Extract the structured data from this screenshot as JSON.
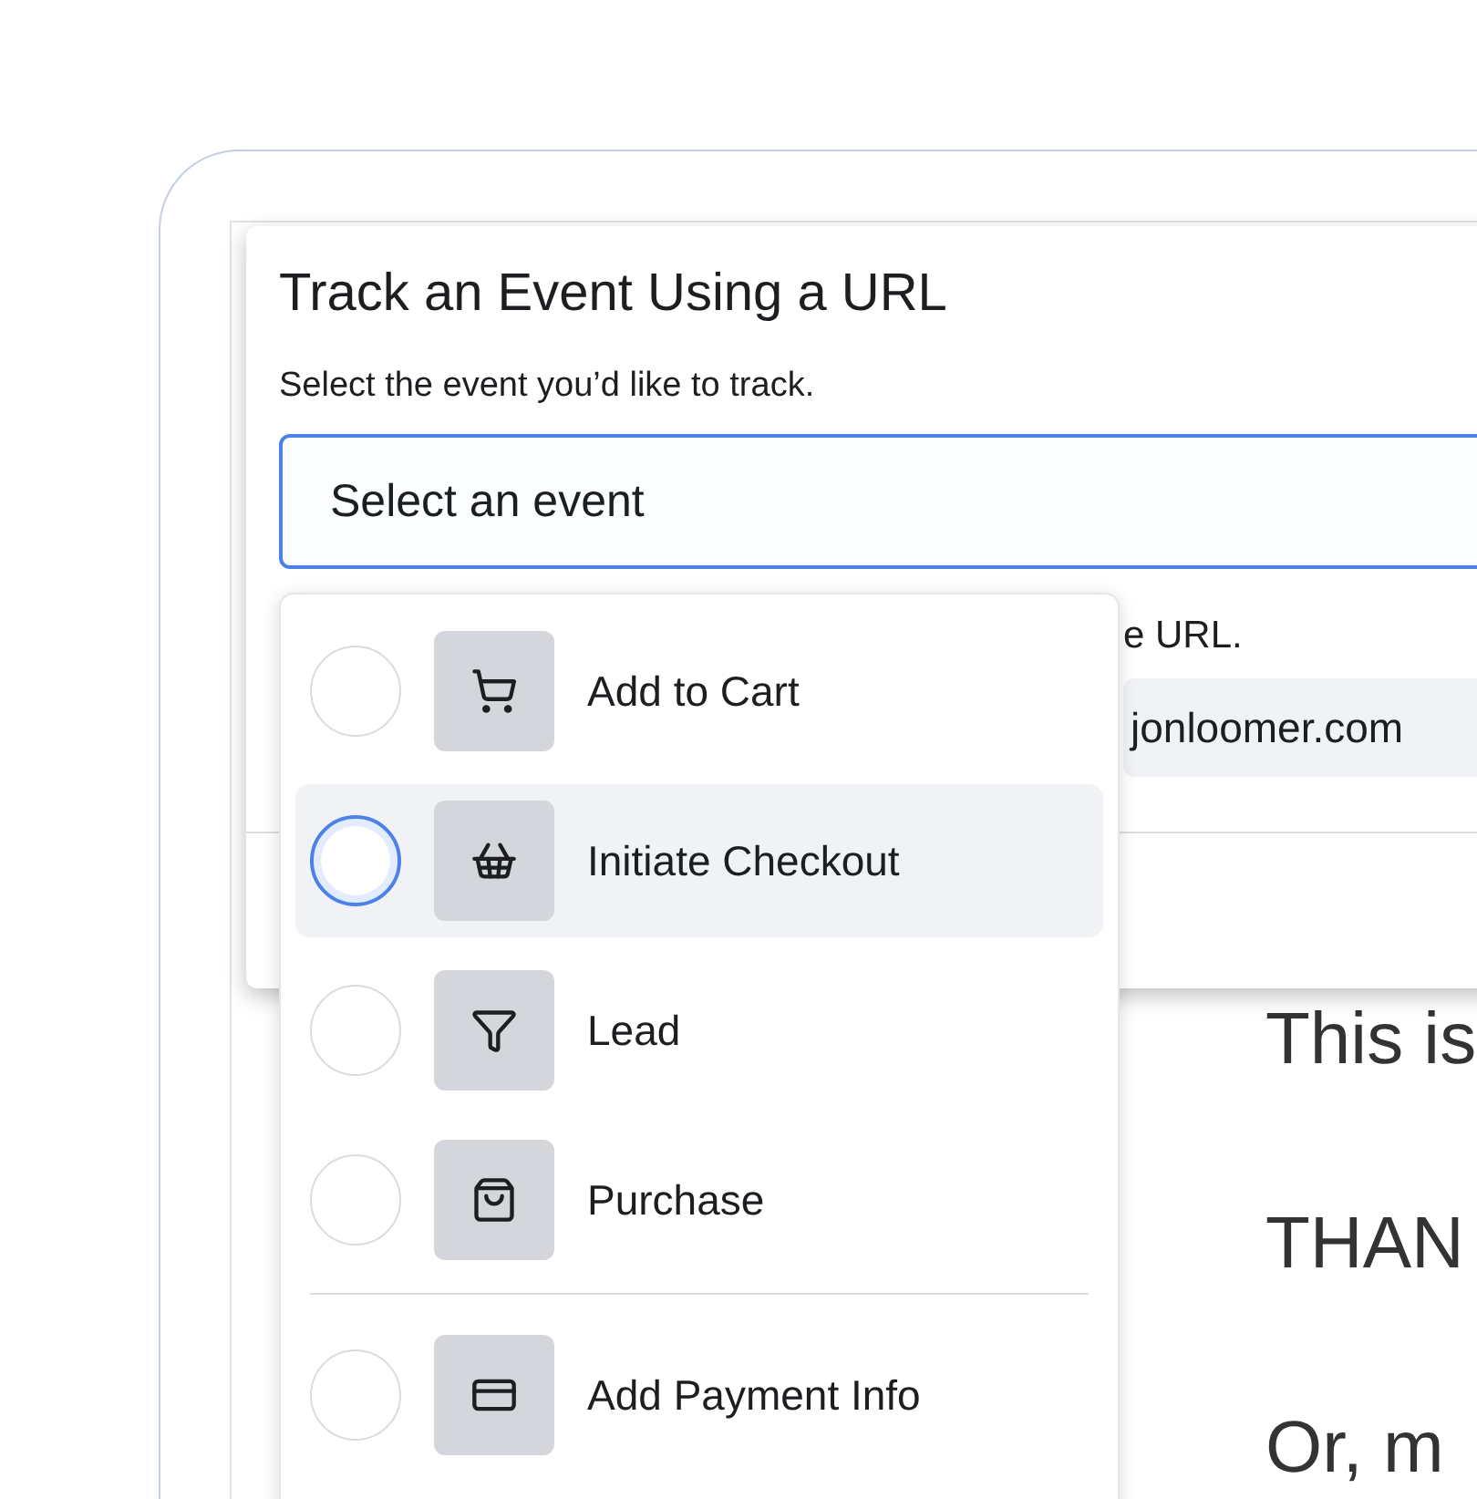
{
  "page_text": [
    "This is",
    "THAN",
    "Or, m"
  ],
  "dialog": {
    "title": "Track an Event Using a URL",
    "subtitle": "Select the event you’d like to track.",
    "select": {
      "placeholder": "Select an event"
    },
    "hint": "e URL.",
    "url_field": {
      "value": "jonloomer.com"
    }
  },
  "menu": {
    "sections": [
      [
        {
          "label": "Add to Cart",
          "selected": false
        },
        {
          "label": "Initiate Checkout",
          "selected": true
        },
        {
          "label": "Lead",
          "selected": false
        },
        {
          "label": "Purchase",
          "selected": false
        }
      ],
      [
        {
          "label": "Add Payment Info",
          "selected": false
        }
      ]
    ]
  }
}
